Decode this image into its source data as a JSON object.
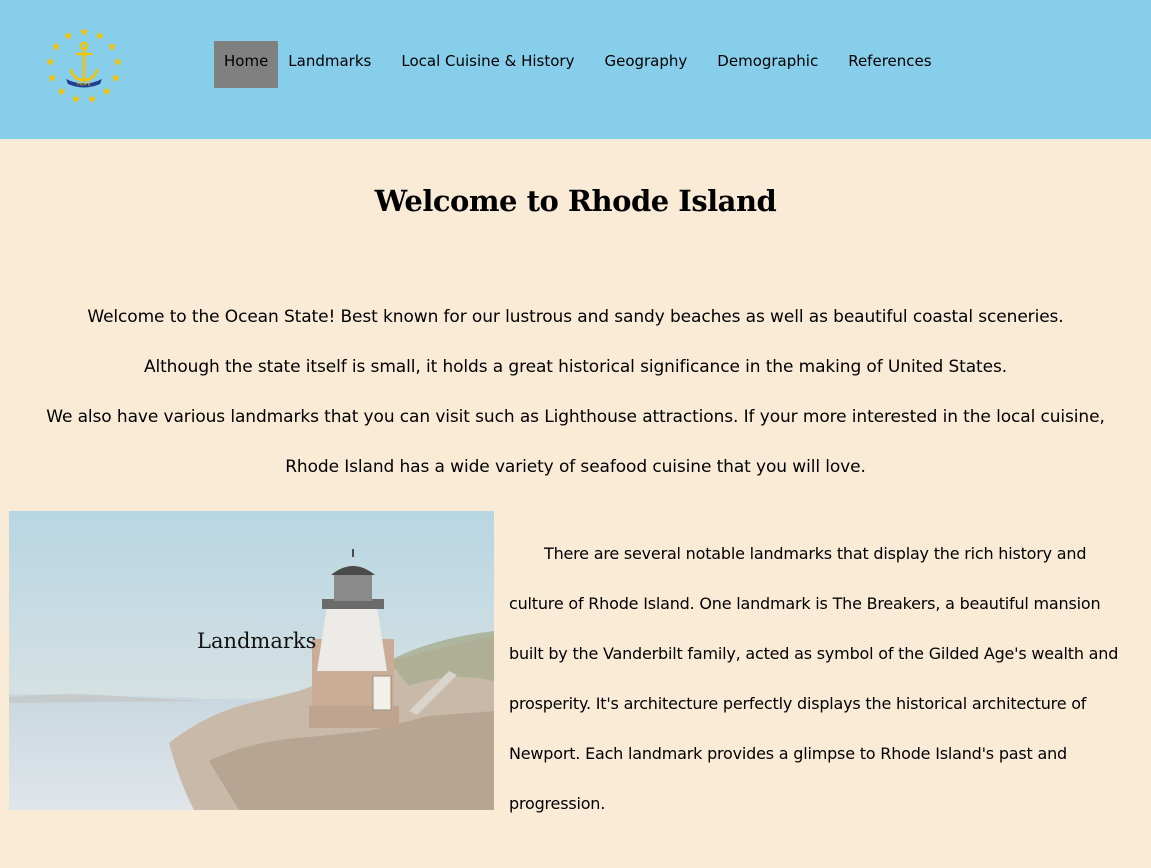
{
  "nav": {
    "items": [
      {
        "label": "Home",
        "active": true
      },
      {
        "label": "Landmarks",
        "active": false
      },
      {
        "label": "Local Cuisine & History",
        "active": false
      },
      {
        "label": "Geography",
        "active": false
      },
      {
        "label": "Demographic",
        "active": false
      },
      {
        "label": "References",
        "active": false
      }
    ]
  },
  "logo": {
    "icon": "anchor-seal-icon",
    "ribbon_text": "HOPE",
    "star_color": "#f2c200"
  },
  "main": {
    "title": "Welcome to Rhode Island",
    "intro_lines": [
      "Welcome to the Ocean State! Best known for our lustrous and sandy beaches as well as beautiful coastal sceneries.",
      "Although the state itself is small, it holds a great historical significance in the making of United States.",
      "We also have various landmarks that you can visit such as Lighthouse attractions. If your more interested in the local cuisine,",
      "Rhode Island has a wide variety of seafood cuisine that you will love."
    ],
    "photo_label": "Landmarks",
    "landmark_paragraph": "There are several notable landmarks that display the rich history and culture of Rhode Island. One landmark is The Breakers, a beautiful mansion built by the Vanderbilt family, acted as symbol of the Gilded Age's wealth and prosperity. It's architecture perfectly displays the historical architecture of Newport. Each landmark provides a glimpse to Rhode Island's past and progression."
  },
  "colors": {
    "header_bg": "#87ceeb",
    "page_bg": "#faebd7",
    "active_nav": "#808080"
  }
}
